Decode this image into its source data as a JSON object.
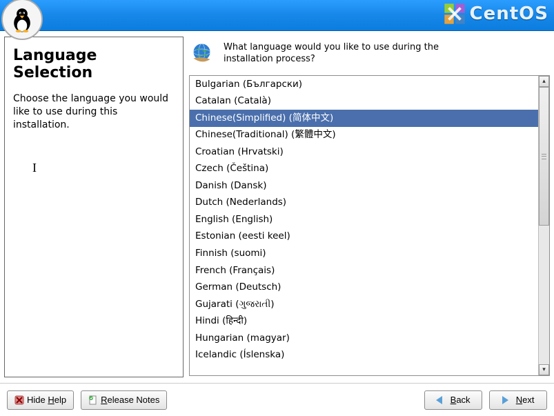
{
  "brand": {
    "name": "CentOS"
  },
  "sidebar": {
    "title": "Language Selection",
    "description": "Choose the language you would like to use during this installation."
  },
  "prompt": "What language would you like to use during the installation process?",
  "languages": [
    "Bulgarian (Български)",
    "Catalan (Català)",
    "Chinese(Simplified) (简体中文)",
    "Chinese(Traditional) (繁體中文)",
    "Croatian (Hrvatski)",
    "Czech (Čeština)",
    "Danish (Dansk)",
    "Dutch (Nederlands)",
    "English (English)",
    "Estonian (eesti keel)",
    "Finnish (suomi)",
    "French (Français)",
    "German (Deutsch)",
    "Gujarati (ગુજરાતી)",
    "Hindi (हिन्दी)",
    "Hungarian (magyar)",
    "Icelandic (Íslenska)"
  ],
  "selected_index": 2,
  "buttons": {
    "hide_help_pre": "Hide ",
    "hide_help_u": "H",
    "hide_help_post": "elp",
    "release_u": "R",
    "release_post": "elease Notes",
    "back_u": "B",
    "back_post": "ack",
    "next_u": "N",
    "next_post": "ext"
  }
}
